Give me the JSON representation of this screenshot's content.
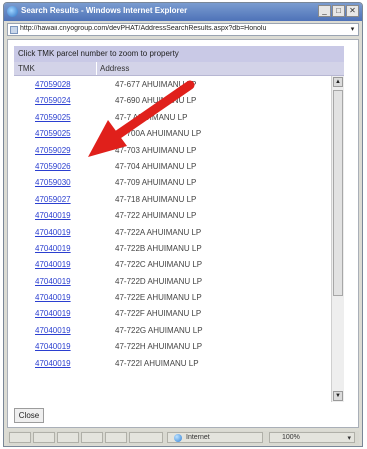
{
  "window": {
    "title": "Search Results - Windows Internet Explorer",
    "controls": {
      "minimize": "_",
      "maximize": "□",
      "close": "✕"
    }
  },
  "address_bar": {
    "url": "http://hawaii.cnyogroup.com/devPHAT/AddressSearchResults.aspx?db=Honolu",
    "dropdown": "▾"
  },
  "page": {
    "caption": "Click TMK parcel number to zoom to property",
    "columns": {
      "tmk": "TMK",
      "address": "Address"
    },
    "rows": [
      {
        "tmk": "47059028",
        "address": "47-677 AHUIMANU LP"
      },
      {
        "tmk": "47059024",
        "address": "47-690 AHUIMANU LP"
      },
      {
        "tmk": "47059025",
        "address": "47-7 AHUIMANU LP"
      },
      {
        "tmk": "47059025",
        "address": "47-700A AHUIMANU LP"
      },
      {
        "tmk": "47059029",
        "address": "47-703 AHUIMANU LP"
      },
      {
        "tmk": "47059026",
        "address": "47-704 AHUIMANU LP"
      },
      {
        "tmk": "47059030",
        "address": "47-709 AHUIMANU LP"
      },
      {
        "tmk": "47059027",
        "address": "47-718 AHUIMANU LP"
      },
      {
        "tmk": "47040019",
        "address": "47-722 AHUIMANU LP"
      },
      {
        "tmk": "47040019",
        "address": "47-722A AHUIMANU LP"
      },
      {
        "tmk": "47040019",
        "address": "47-722B AHUIMANU LP"
      },
      {
        "tmk": "47040019",
        "address": "47-722C AHUIMANU LP"
      },
      {
        "tmk": "47040019",
        "address": "47-722D AHUIMANU LP"
      },
      {
        "tmk": "47040019",
        "address": "47-722E AHUIMANU LP"
      },
      {
        "tmk": "47040019",
        "address": "47-722F AHUIMANU LP"
      },
      {
        "tmk": "47040019",
        "address": "47-722G AHUIMANU LP"
      },
      {
        "tmk": "47040019",
        "address": "47-722H AHUIMANU LP"
      },
      {
        "tmk": "47040019",
        "address": "47-722I AHUIMANU LP"
      }
    ],
    "close_label": "Close"
  },
  "scrollbar": {
    "up": "▲",
    "down": "▼"
  },
  "status_bar": {
    "zone": "Internet",
    "zoom": "100%",
    "zoom_drop": "▾"
  },
  "colors": {
    "annotation_arrow": "#e0201b",
    "link": "#2b3fd0"
  }
}
